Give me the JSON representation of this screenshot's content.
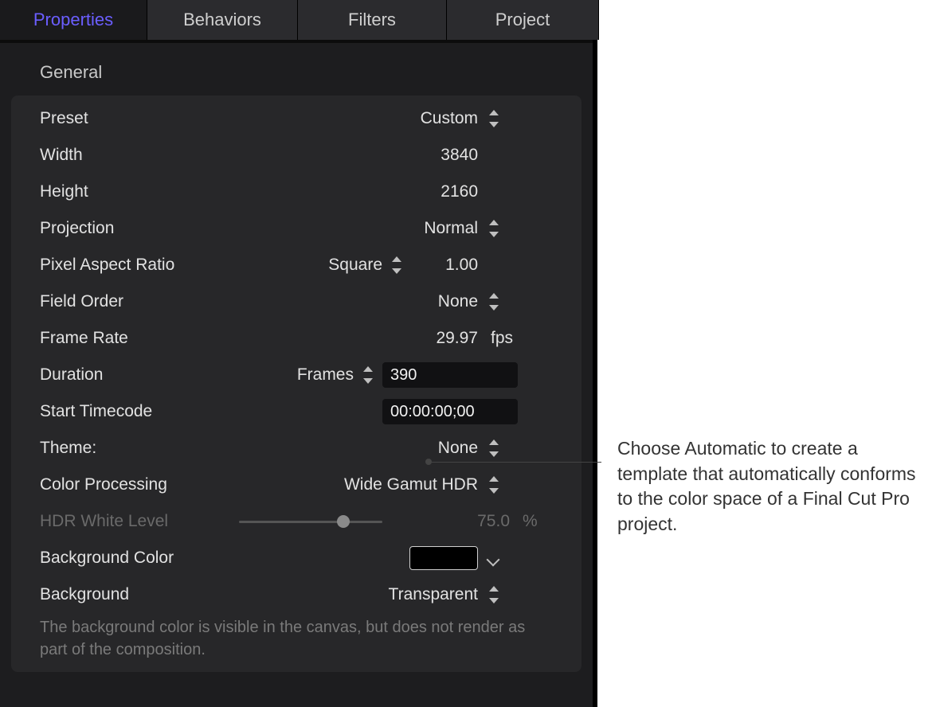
{
  "tabs": {
    "properties": "Properties",
    "behaviors": "Behaviors",
    "filters": "Filters",
    "project": "Project"
  },
  "section": {
    "general": "General"
  },
  "rows": {
    "preset": {
      "label": "Preset",
      "value": "Custom"
    },
    "width": {
      "label": "Width",
      "value": "3840"
    },
    "height": {
      "label": "Height",
      "value": "2160"
    },
    "projection": {
      "label": "Projection",
      "value": "Normal"
    },
    "par": {
      "label": "Pixel Aspect Ratio",
      "value": "Square",
      "num": "1.00"
    },
    "field_order": {
      "label": "Field Order",
      "value": "None"
    },
    "frame_rate": {
      "label": "Frame Rate",
      "value": "29.97",
      "unit": "fps"
    },
    "duration": {
      "label": "Duration",
      "unitSel": "Frames",
      "num": "390"
    },
    "start_tc": {
      "label": "Start Timecode",
      "num": "00:00:00;00"
    },
    "theme": {
      "label": "Theme:",
      "value": "None"
    },
    "color_proc": {
      "label": "Color Processing",
      "value": "Wide Gamut HDR"
    },
    "hdr_white": {
      "label": "HDR White Level",
      "value": "75.0",
      "unit": "%",
      "slider_pct": 75
    },
    "bg_color": {
      "label": "Background Color",
      "swatch": "#000000"
    },
    "background": {
      "label": "Background",
      "value": "Transparent"
    }
  },
  "help_text": "The background color is visible in the canvas, but does not render as part of the composition.",
  "callout": "Choose Automatic to create a template that automatically conforms to the color space of a Final Cut Pro project."
}
